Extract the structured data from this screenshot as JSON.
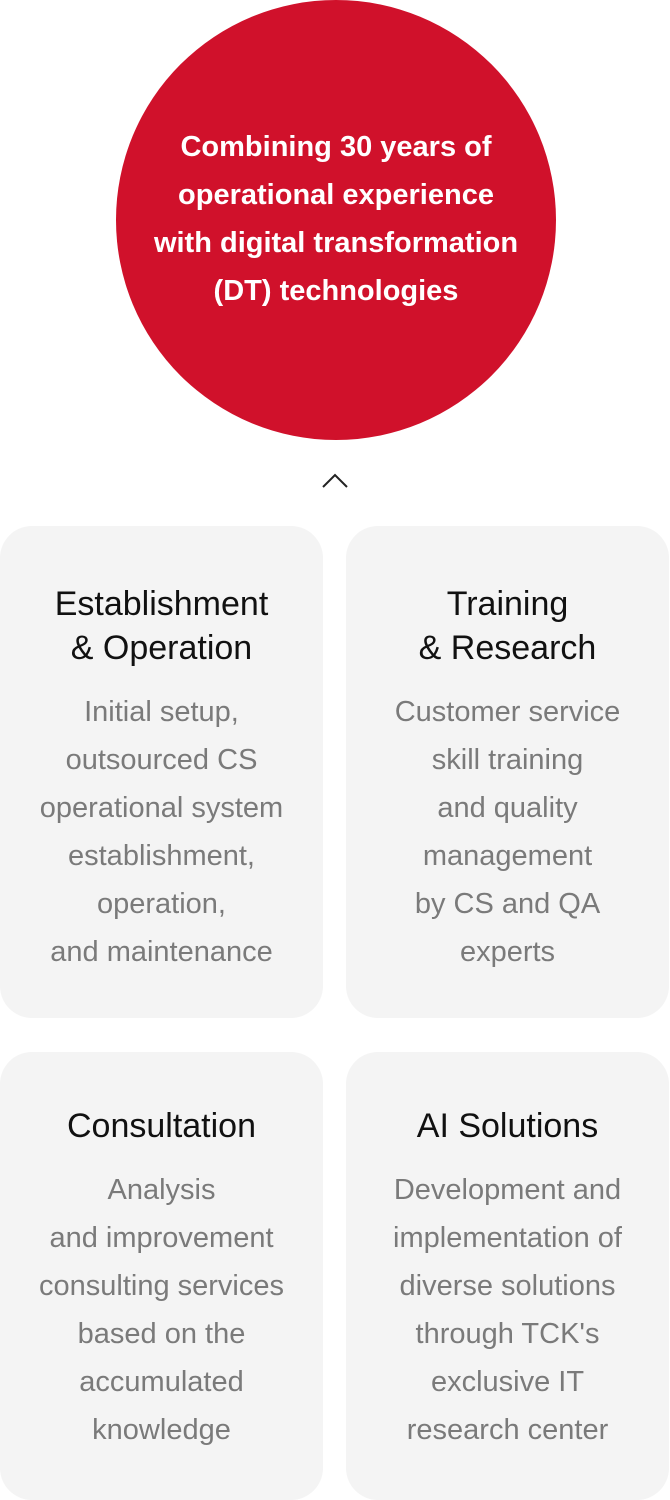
{
  "hero": {
    "lines": [
      "Combining 30 years of",
      "operational experience",
      "with digital transformation",
      "(DT) technologies"
    ],
    "color": "#d0112b"
  },
  "chevron_icon": "chevron-up-icon",
  "cards": [
    {
      "title_lines": [
        "Establishment",
        "& Operation"
      ],
      "desc_lines": [
        "Initial setup,",
        "outsourced CS",
        "operational system",
        "establishment,",
        "operation,",
        "and maintenance"
      ]
    },
    {
      "title_lines": [
        "Training",
        "& Research"
      ],
      "desc_lines": [
        "Customer service",
        "skill training",
        "and quality",
        "management",
        "by CS and QA",
        "experts"
      ]
    },
    {
      "title_lines": [
        "Consultation"
      ],
      "desc_lines": [
        "Analysis",
        "and improvement",
        "consulting services",
        "based on the",
        "accumulated",
        "knowledge"
      ]
    },
    {
      "title_lines": [
        "AI Solutions"
      ],
      "desc_lines": [
        "Development and",
        "implementation of",
        "diverse solutions",
        "through TCK's",
        "exclusive IT",
        "research center"
      ]
    }
  ]
}
